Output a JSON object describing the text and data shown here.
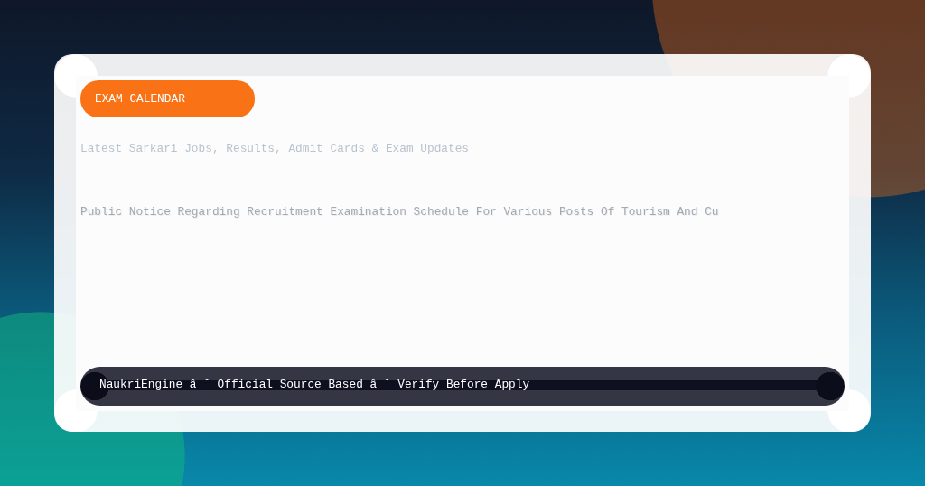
{
  "category_tag": "EXAM CALENDAR",
  "tagline": "Latest Sarkari Jobs, Results, Admit Cards & Exam Updates",
  "headline": "Public Notice Regarding Recruitment Examination Schedule For Various Posts Of Tourism And Cu",
  "footer_bar": {
    "text": "NaukriEngine â ˘ Official Source Based â ˘ Verify Before Apply"
  }
}
